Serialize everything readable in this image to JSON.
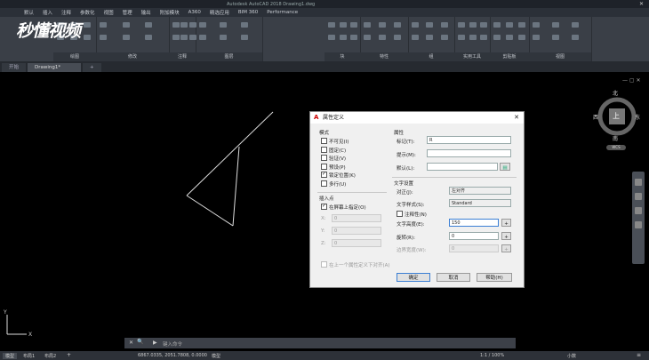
{
  "app": {
    "title": "Autodesk AutoCAD 2018    Drawing1.dwg",
    "watermark": "秒懂视频",
    "menus": [
      "默认",
      "插入",
      "注释",
      "参数化",
      "视图",
      "管理",
      "输出",
      "附加模块",
      "A360",
      "精选应用",
      "BIM 360",
      "Performance"
    ],
    "ribbon_groups": [
      "绘图",
      "修改",
      "注释",
      "图层",
      "块",
      "特性",
      "组",
      "实用工具",
      "剪贴板",
      "视图"
    ],
    "tabs": [
      "开始",
      "Drawing1*"
    ]
  },
  "viewcube": {
    "top": "上",
    "north": "北",
    "south": "南",
    "west": "西",
    "east": "东",
    "face": "上",
    "wcs": "WCS"
  },
  "dialog": {
    "title": "属性定义",
    "mode_header": "模式",
    "modes": [
      {
        "label": "不可见(I)",
        "checked": false
      },
      {
        "label": "固定(C)",
        "checked": false
      },
      {
        "label": "验证(V)",
        "checked": false
      },
      {
        "label": "预设(P)",
        "checked": false
      },
      {
        "label": "锁定位置(K)",
        "checked": true
      },
      {
        "label": "多行(U)",
        "checked": false
      }
    ],
    "attr_header": "属性",
    "tag_label": "标记(T):",
    "tag_value": "R",
    "prompt_label": "提示(M):",
    "prompt_value": "",
    "default_label": "默认(L):",
    "default_value": "",
    "insert_header": "插入点",
    "onscreen_label": "在屏幕上指定(O)",
    "onscreen_checked": true,
    "x_label": "X:",
    "x_value": "0",
    "y_label": "Y:",
    "y_value": "0",
    "z_label": "Z:",
    "z_value": "0",
    "text_header": "文字设置",
    "just_label": "对正(J):",
    "just_value": "左对齐",
    "style_label": "文字样式(S):",
    "style_value": "Standard",
    "annot_label": "注释性(N)",
    "height_label": "文字高度(E):",
    "height_value": "150",
    "rotation_label": "旋转(R):",
    "rotation_value": "0",
    "boundary_label": "边界宽度(W):",
    "boundary_value": "0",
    "align_label": "在上一个属性定义下对齐(A)",
    "ok": "确定",
    "cancel": "取消",
    "help": "帮助(H)"
  },
  "command": {
    "placeholder": "键入命令"
  },
  "status": {
    "coords": "6867.0335, 2051.7808, 0.0000",
    "model": "模型",
    "tabs": [
      "模型",
      "布局1",
      "布局2"
    ],
    "scale": "1:1 / 100%",
    "units": "小数"
  }
}
